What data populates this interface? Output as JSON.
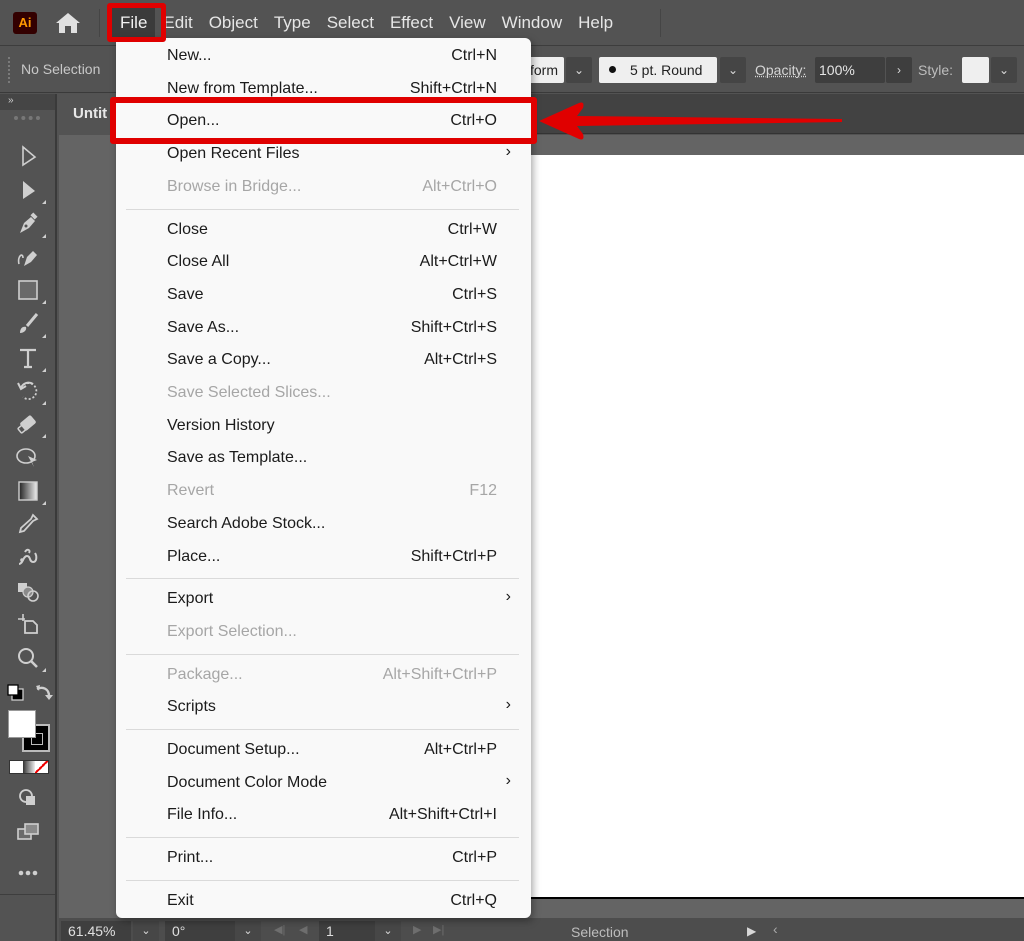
{
  "app": {
    "logo_text": "Ai",
    "menubar": {
      "items": [
        {
          "label": "File",
          "active": true
        },
        {
          "label": "Edit"
        },
        {
          "label": "Object"
        },
        {
          "label": "Type"
        },
        {
          "label": "Select"
        },
        {
          "label": "Effect"
        },
        {
          "label": "View"
        },
        {
          "label": "Window"
        },
        {
          "label": "Help"
        }
      ]
    }
  },
  "controlbar": {
    "selection_status": "No Selection",
    "transform_partial": "form",
    "stroke_profile": "5 pt. Round",
    "opacity_label": "Opacity:",
    "opacity_value": "100%",
    "style_label": "Style:"
  },
  "document": {
    "tab_title": "Untit"
  },
  "toolbar": {
    "collapse_label": "»",
    "tools": [
      "selection-tool",
      "direct-selection-tool",
      "pen-tool",
      "curvature-tool",
      "rectangle-tool",
      "paintbrush-tool",
      "type-tool",
      "rotate-tool",
      "eraser-tool",
      "shape-builder-tool",
      "gradient-tool",
      "eyedropper-tool",
      "puppet-warp-tool",
      "blend-tool",
      "artboard-tool",
      "zoom-tool"
    ],
    "fill_color": "#ffffff",
    "stroke_color": "#000000"
  },
  "file_menu": {
    "items": [
      {
        "label": "New...",
        "shortcut": "Ctrl+N",
        "enabled": true
      },
      {
        "label": "New from Template...",
        "shortcut": "Shift+Ctrl+N",
        "enabled": true
      },
      {
        "label": "Open...",
        "shortcut": "Ctrl+O",
        "enabled": true,
        "highlighted": true
      },
      {
        "label": "Open Recent Files",
        "submenu": true,
        "enabled": true
      },
      {
        "label": "Browse in Bridge...",
        "shortcut": "Alt+Ctrl+O",
        "enabled": false
      },
      {
        "separator": true
      },
      {
        "label": "Close",
        "shortcut": "Ctrl+W",
        "enabled": true
      },
      {
        "label": "Close All",
        "shortcut": "Alt+Ctrl+W",
        "enabled": true
      },
      {
        "label": "Save",
        "shortcut": "Ctrl+S",
        "enabled": true
      },
      {
        "label": "Save As...",
        "shortcut": "Shift+Ctrl+S",
        "enabled": true
      },
      {
        "label": "Save a Copy...",
        "shortcut": "Alt+Ctrl+S",
        "enabled": true
      },
      {
        "label": "Save Selected Slices...",
        "enabled": false
      },
      {
        "label": "Version History",
        "enabled": true
      },
      {
        "label": "Save as Template...",
        "enabled": true
      },
      {
        "label": "Revert",
        "shortcut": "F12",
        "enabled": false
      },
      {
        "label": "Search Adobe Stock...",
        "enabled": true
      },
      {
        "label": "Place...",
        "shortcut": "Shift+Ctrl+P",
        "enabled": true
      },
      {
        "separator": true
      },
      {
        "label": "Export",
        "submenu": true,
        "enabled": true
      },
      {
        "label": "Export Selection...",
        "enabled": false
      },
      {
        "separator": true
      },
      {
        "label": "Package...",
        "shortcut": "Alt+Shift+Ctrl+P",
        "enabled": false
      },
      {
        "label": "Scripts",
        "submenu": true,
        "enabled": true
      },
      {
        "separator": true
      },
      {
        "label": "Document Setup...",
        "shortcut": "Alt+Ctrl+P",
        "enabled": true
      },
      {
        "label": "Document Color Mode",
        "submenu": true,
        "enabled": true
      },
      {
        "label": "File Info...",
        "shortcut": "Alt+Shift+Ctrl+I",
        "enabled": true
      },
      {
        "separator": true
      },
      {
        "label": "Print...",
        "shortcut": "Ctrl+P",
        "enabled": true
      },
      {
        "separator": true
      },
      {
        "label": "Exit",
        "shortcut": "Ctrl+Q",
        "enabled": true
      }
    ]
  },
  "statusbar": {
    "zoom": "61.45%",
    "rotation": "0°",
    "artboard_number": "1",
    "current_tool": "Selection"
  },
  "annotation": {
    "highlight_color": "#e00000"
  }
}
